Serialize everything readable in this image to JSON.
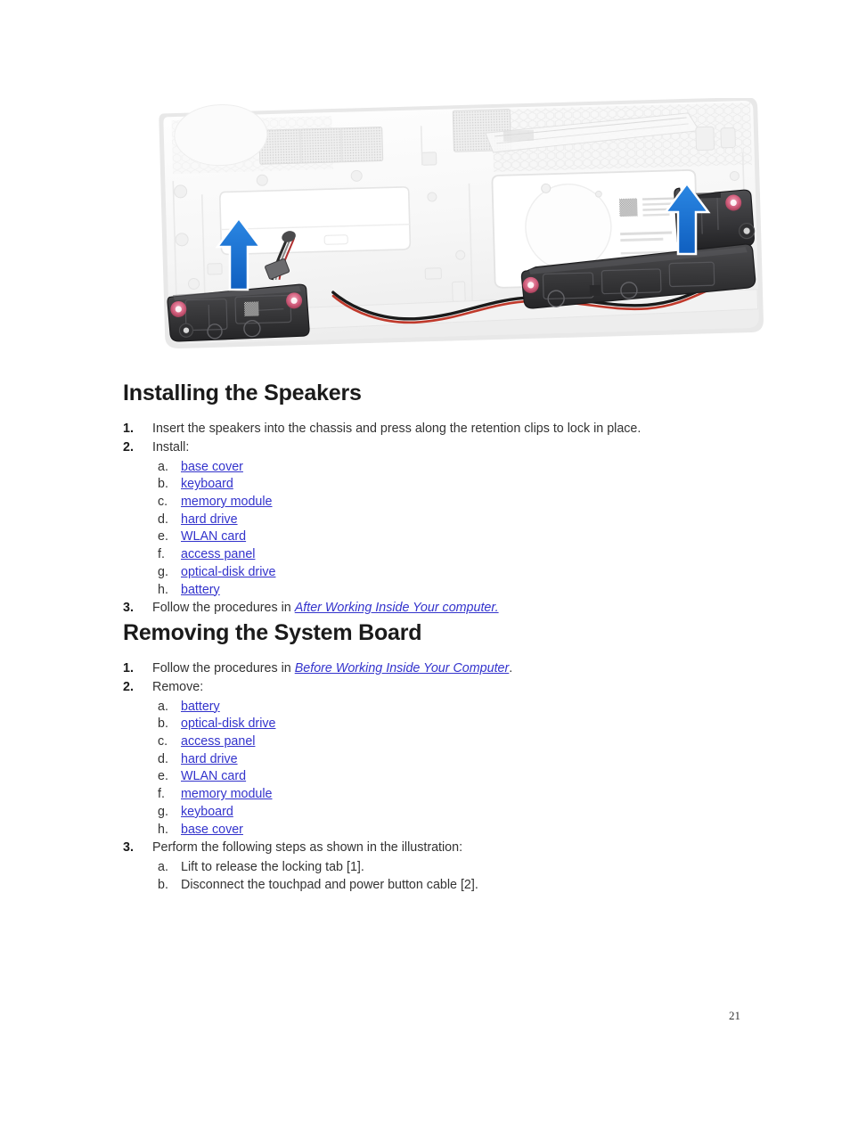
{
  "figure": {
    "alt_name": "laptop-chassis-speaker-removal-illustration",
    "description": "Laptop palmrest chassis viewed from inside with left and right speaker assemblies and blue upward callout arrows",
    "arrow_color": "#1a6fd4",
    "speaker_color": "#3a3a3c",
    "grommet_color": "#d4607f",
    "cable_colors": [
      "#1a1a1a",
      "#c0392b"
    ],
    "chassis_color": "#f4f4f4"
  },
  "sections": [
    {
      "heading": "Installing the Speakers",
      "steps": [
        {
          "number": "1.",
          "text": "Insert the speakers into the chassis and press along the retention clips to lock in place."
        },
        {
          "number": "2.",
          "text": "Install:",
          "substeps": [
            {
              "letter": "a.",
              "link": "base cover"
            },
            {
              "letter": "b.",
              "link": "keyboard"
            },
            {
              "letter": "c.",
              "link": "memory module"
            },
            {
              "letter": "d.",
              "link": "hard drive"
            },
            {
              "letter": "e.",
              "link": "WLAN card"
            },
            {
              "letter": "f.",
              "link": "access panel"
            },
            {
              "letter": "g.",
              "link": "optical-disk drive"
            },
            {
              "letter": "h.",
              "link": "battery"
            }
          ]
        },
        {
          "number": "3.",
          "text_before": "Follow the procedures in ",
          "link": "After Working Inside Your computer.",
          "text_after": ""
        }
      ]
    },
    {
      "heading": "Removing the System Board",
      "steps": [
        {
          "number": "1.",
          "text_before": "Follow the procedures in ",
          "link": "Before Working Inside Your Computer",
          "text_after": "."
        },
        {
          "number": "2.",
          "text": "Remove:",
          "substeps": [
            {
              "letter": "a.",
              "link": "battery"
            },
            {
              "letter": "b.",
              "link": "optical-disk drive"
            },
            {
              "letter": "c.",
              "link": "access panel"
            },
            {
              "letter": "d.",
              "link": "hard drive"
            },
            {
              "letter": "e.",
              "link": "WLAN card"
            },
            {
              "letter": "f.",
              "link": "memory module"
            },
            {
              "letter": "g.",
              "link": "keyboard"
            },
            {
              "letter": "h.",
              "link": "base cover"
            }
          ]
        },
        {
          "number": "3.",
          "text": "Perform the following steps as shown in the illustration:",
          "substeps_plain": [
            {
              "letter": "a.",
              "text": "Lift to release the locking tab [1]."
            },
            {
              "letter": "b.",
              "text": "Disconnect the touchpad and power button cable [2]."
            }
          ]
        }
      ]
    }
  ],
  "footer": {
    "page_number": "21"
  },
  "colors": {
    "link": "#3333cc",
    "body_text": "#333333",
    "heading_text": "#1a1a1a",
    "background": "#ffffff"
  }
}
